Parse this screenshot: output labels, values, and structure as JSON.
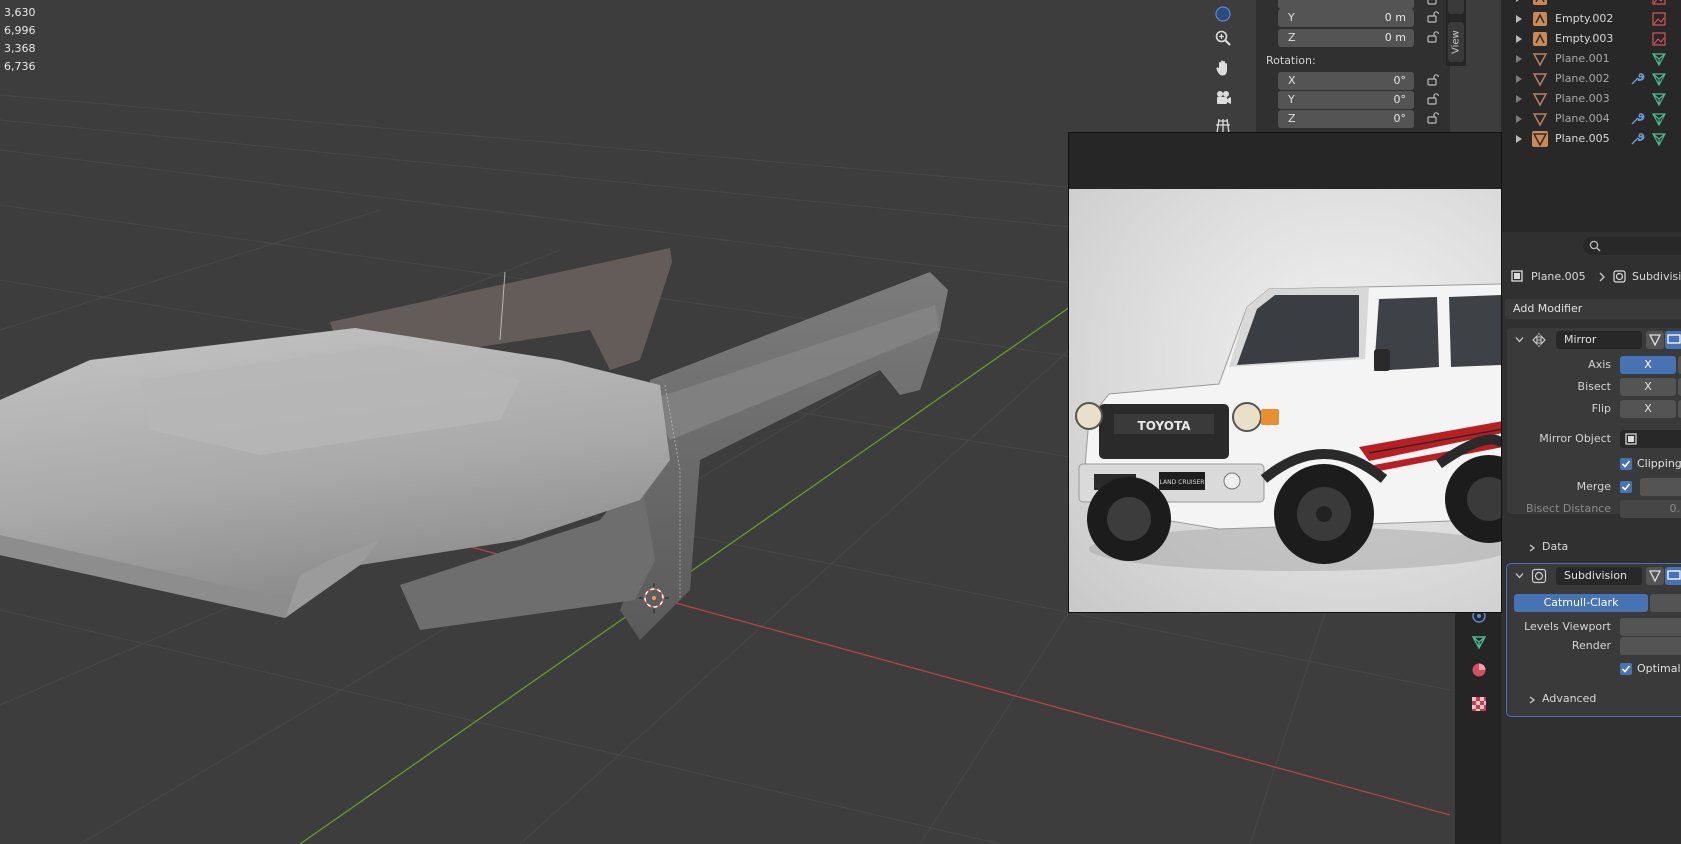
{
  "viewport": {
    "stats": [
      "3,630",
      "6,996",
      "3,368",
      "6,736"
    ]
  },
  "npanel": {
    "location": [
      {
        "axis": "Y",
        "value": "0 m"
      },
      {
        "axis": "Z",
        "value": "0 m"
      }
    ],
    "rotation_label": "Rotation:",
    "rotation": [
      {
        "axis": "X",
        "value": "0°"
      },
      {
        "axis": "Y",
        "value": "0°"
      },
      {
        "axis": "Z",
        "value": "0°"
      }
    ],
    "tabs": [
      "View"
    ]
  },
  "outliner": {
    "items": [
      {
        "name": "Empty.002",
        "type": "empty",
        "dim": false
      },
      {
        "name": "Empty.003",
        "type": "empty",
        "dim": false
      },
      {
        "name": "Plane.001",
        "type": "mesh",
        "dim": true
      },
      {
        "name": "Plane.002",
        "type": "mesh",
        "dim": true
      },
      {
        "name": "Plane.003",
        "type": "mesh",
        "dim": true
      },
      {
        "name": "Plane.004",
        "type": "mesh",
        "dim": true
      },
      {
        "name": "Plane.005",
        "type": "mesh",
        "dim": false
      }
    ]
  },
  "properties": {
    "breadcrumb_object": "Plane.005",
    "breadcrumb_modifier": "Subdivisi",
    "add_modifier": "Add Modifier",
    "mirror": {
      "name": "Mirror",
      "axis_label": "Axis",
      "bisect_label": "Bisect",
      "flip_label": "Flip",
      "x": "X",
      "mirror_object_label": "Mirror Object",
      "clipping_label": "Clipping",
      "merge_label": "Merge",
      "bisect_distance_label": "Bisect Distance",
      "bisect_distance_value": "0.",
      "data_label": "Data"
    },
    "subdivision": {
      "name": "Subdivision",
      "catmull": "Catmull-Clark",
      "levels_viewport_label": "Levels Viewport",
      "render_label": "Render",
      "optimal_label": "Optimal D",
      "advanced_label": "Advanced"
    }
  },
  "reference_image": {
    "brand": "TOYOTA",
    "plate": "LAND CRUISER"
  },
  "colors": {
    "accent": "#4772b3",
    "x_axis": "#b5424a",
    "y_axis": "#6a9a23"
  }
}
